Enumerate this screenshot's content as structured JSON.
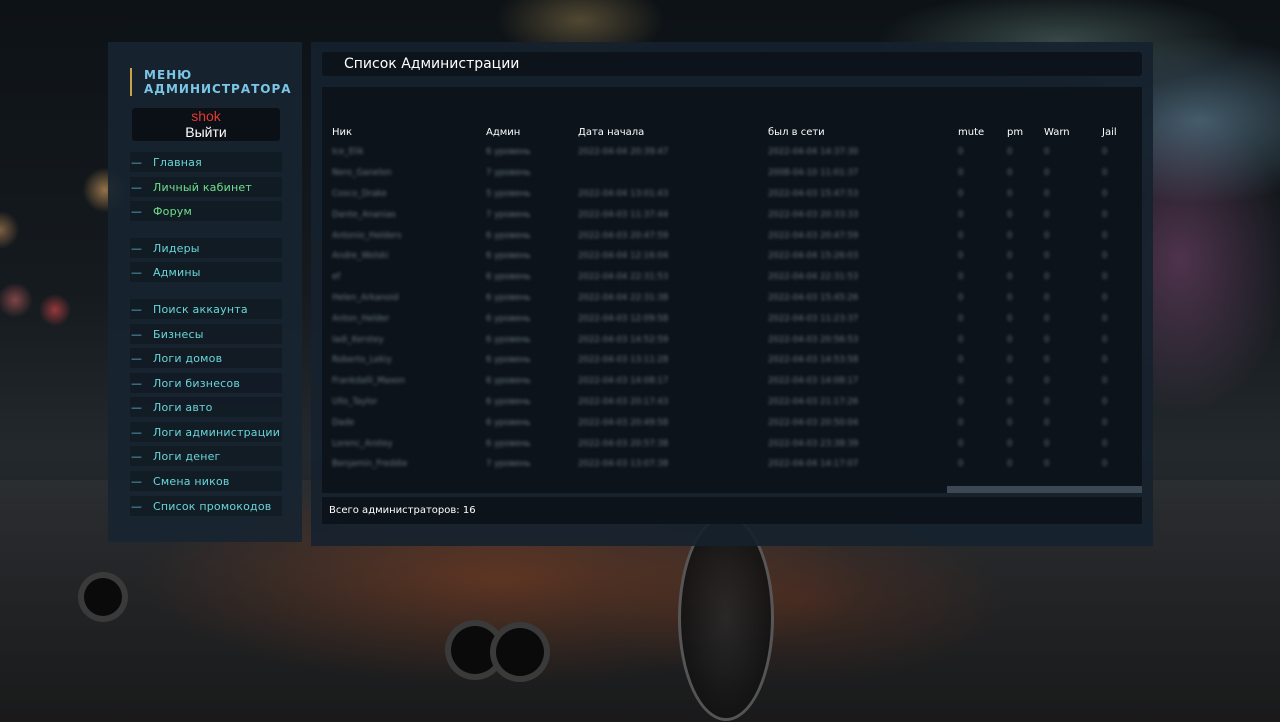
{
  "sidebar": {
    "title_line1": "МЕНЮ",
    "title_line2": "АДМИНИСТРАТОРА",
    "username": "shok",
    "logout_label": "Выйти",
    "items": [
      {
        "label": "Главная"
      },
      {
        "label": "Личный кабинет"
      },
      {
        "label": "Форум"
      },
      {
        "label": "Лидеры"
      },
      {
        "label": "Админы"
      },
      {
        "label": "Поиск аккаунта"
      },
      {
        "label": "Бизнесы"
      },
      {
        "label": "Логи домов"
      },
      {
        "label": "Логи бизнесов"
      },
      {
        "label": "Логи авто"
      },
      {
        "label": "Логи администрации"
      },
      {
        "label": "Логи денег"
      },
      {
        "label": "Смена ников"
      },
      {
        "label": "Список промокодов"
      }
    ],
    "dash": "—",
    "colors": {
      "accent": "#68d6d9",
      "active": "#6fe08b",
      "username": "#e23a2f",
      "bar": "#c9a24a"
    }
  },
  "main": {
    "title": "Список Администрации",
    "columns": [
      "Ник",
      "Админ",
      "Дата начала",
      "был в сети",
      "mute",
      "pm",
      "Warn",
      "Jail"
    ],
    "rows": [
      [
        "Ice_Elik",
        "6 уровень",
        "2022-04-04 20:39:47",
        "2022-04-04 14:37:30",
        "0",
        "0",
        "0",
        "0"
      ],
      [
        "Nero_Ganelon",
        "7 уровень",
        "",
        "2008-04-10 11:01:37",
        "0",
        "0",
        "0",
        "0"
      ],
      [
        "Cosco_Drake",
        "5 уровень",
        "2022-04-04 13:01:43",
        "2022-04-03 15:47:53",
        "0",
        "0",
        "0",
        "0"
      ],
      [
        "Dante_Ananias",
        "7 уровень",
        "2022-04-03 11:37:44",
        "2022-04-03 20:33:33",
        "0",
        "0",
        "0",
        "0"
      ],
      [
        "Antonio_Helders",
        "6 уровень",
        "2022-04-03 20:47:59",
        "2022-04-03 20:47:59",
        "0",
        "0",
        "0",
        "0"
      ],
      [
        "Andre_Wolski",
        "6 уровень",
        "2022-04-04 12:16:04",
        "2022-04-04 15:26:03",
        "0",
        "0",
        "0",
        "0"
      ],
      [
        "ef",
        "6 уровень",
        "2022-04-04 22:31:53",
        "2022-04-04 22:31:53",
        "0",
        "0",
        "0",
        "0"
      ],
      [
        "Helen_Arkanoid",
        "6 уровень",
        "2022-04-04 22:31:38",
        "2022-04-03 15:45:26",
        "0",
        "0",
        "0",
        "0"
      ],
      [
        "Anton_Helder",
        "6 уровень",
        "2022-04-03 12:09:58",
        "2022-04-03 11:23:37",
        "0",
        "0",
        "0",
        "0"
      ],
      [
        "Iadi_Kerstey",
        "6 уровень",
        "2022-04-03 14:52:59",
        "2022-04-03 20:56:53",
        "0",
        "0",
        "0",
        "0"
      ],
      [
        "Roberto_Lekiy",
        "6 уровень",
        "2022-04-03 13:11:28",
        "2022-04-03 14:53:58",
        "0",
        "0",
        "0",
        "0"
      ],
      [
        "Frankdalli_Maxon",
        "6 уровень",
        "2022-04-03 14:08:17",
        "2022-04-03 14:08:17",
        "0",
        "0",
        "0",
        "0"
      ],
      [
        "Ullo_Taylor",
        "6 уровень",
        "2022-04-03 20:17:43",
        "2022-04-03 21:17:26",
        "0",
        "0",
        "0",
        "0"
      ],
      [
        "Dade",
        "6 уровень",
        "2022-04-03 20:49:58",
        "2022-04-03 20:50:04",
        "0",
        "0",
        "0",
        "0"
      ],
      [
        "Lorenc_Arotey",
        "6 уровень",
        "2022-04-03 20:57:38",
        "2022-04-03 23:38:39",
        "0",
        "0",
        "0",
        "0"
      ],
      [
        "Benjamin_Freddie",
        "7 уровень",
        "2022-04-03 13:07:38",
        "2022-04-04 14:17:07",
        "0",
        "0",
        "0",
        "0"
      ]
    ],
    "footer_text": "Всего администраторов: 16"
  }
}
